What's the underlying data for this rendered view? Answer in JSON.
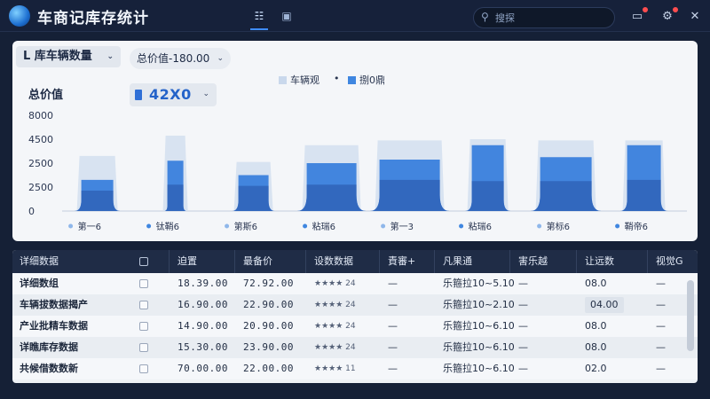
{
  "app": {
    "title": "车商记库存统计",
    "search_placeholder": "搜探"
  },
  "toolbar": {
    "dimension_select": "L 库车辆数量",
    "filter_select": "总价值-180.00",
    "metric_label": "总价值",
    "metric_value": "42X0"
  },
  "legend": [
    {
      "label": "车辆观",
      "color": "#c9d8ec"
    },
    {
      "label": "•",
      "color": ""
    },
    {
      "label": "捌0鼎",
      "color": "#3f86e0"
    }
  ],
  "chart_data": {
    "type": "bar",
    "title": "",
    "ylim": [
      0,
      8000
    ],
    "yticks": [
      "8000",
      "4500",
      "2500",
      "2500",
      "0"
    ],
    "categories": [
      "第一6",
      "钛鞘6",
      "第斯6",
      "粘瑞6",
      "第一3",
      "粘瑞6",
      "第标6",
      "鞘帝6"
    ],
    "series": [
      {
        "values": [
          4600,
          6300,
          4100,
          5500,
          5900,
          6000,
          5900,
          5900
        ]
      },
      {
        "values": [
          2600,
          4200,
          3000,
          4000,
          4300,
          5500,
          4500,
          5500
        ]
      },
      {
        "values": [
          1700,
          2200,
          2100,
          2200,
          2600,
          2500,
          2500,
          2600
        ]
      }
    ],
    "colors": [
      "#d6e1f0",
      "#3a7fdc",
      "#2f63b8"
    ]
  },
  "table": {
    "columns": [
      "详细数据",
      "☐",
      "迫置",
      "最备价",
      "设数数据",
      "責審+",
      "凡果通",
      "害乐越",
      "让远数",
      "视觉G"
    ],
    "rows": [
      [
        "详细数组",
        "",
        "18.39.00",
        "72.92.00",
        "★★★★ 24",
        "—",
        "乐箍拉10~5.10",
        "—",
        "08.0",
        "—"
      ],
      [
        "车辆拔数据揭产",
        "",
        "16.90.00",
        "22.90.00",
        "★★★★ 24",
        "—",
        "乐箍拉10~2.10",
        "—",
        "04.00",
        "—"
      ],
      [
        "产业批精车数据",
        "",
        "14.90.00",
        "20.90.00",
        "★★★★ 24",
        "—",
        "乐箍拉10~6.10",
        "—",
        "08.0",
        "—"
      ],
      [
        "详瞧库存数据",
        "",
        "15.30.00",
        "23.90.00",
        "★★★★ 24",
        "—",
        "乐箍拉10~6.10",
        "—",
        "08.0",
        "—"
      ],
      [
        "共候借数数新",
        "",
        "70.00.00",
        "22.00.00",
        "★★★★ 11",
        "—",
        "乐箍拉10~6.10",
        "—",
        "02.0",
        "—"
      ]
    ]
  }
}
